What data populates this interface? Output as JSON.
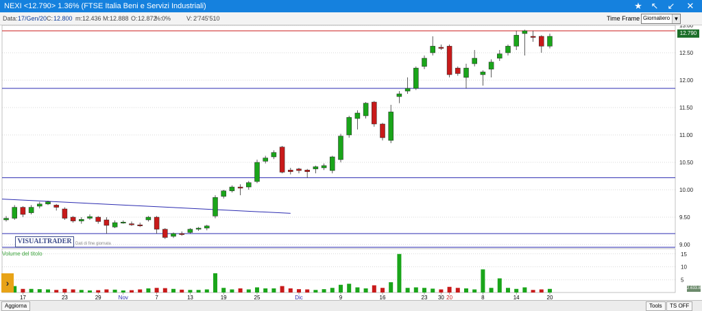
{
  "window": {
    "title": "NEXI <12.790> 1.36%  (FTSE Italia Beni e Servizi Industriali)"
  },
  "infobar": {
    "date_label": "Data:",
    "date": "17/Gen/20",
    "c_label": "C:",
    "c_value": "12.800",
    "m_label": "m:",
    "m_value": "12.436",
    "mx_label": "M:",
    "mx_value": "12.888",
    "o_label": "O:",
    "o_value": "12.872",
    "pct_label": "%:",
    "pct_value": "0%",
    "v_label": "V:",
    "v_value": "2'745'510"
  },
  "timeframe": {
    "label": "Time Frame",
    "selected": "Giornaliero"
  },
  "logo": {
    "text": "VISUALTRADER",
    "sub": "Dati di fine giornata"
  },
  "volume_label": "Volume del titolo",
  "price_badge": "12.790",
  "volume_badge": "2.633.8",
  "bottom": {
    "aggiorna": "Aggiorna",
    "tools": "Tools",
    "ts_off": "TS OFF"
  },
  "colors": {
    "up": "#1aa51a",
    "down": "#c81a1a",
    "titlebar": "#1581de",
    "support_line": "#2a2ab0",
    "resistance_line": "#c81a1a"
  },
  "chart_data": {
    "type": "candlestick",
    "y_ticks": [
      "13.00",
      "12.50",
      "12.00",
      "11.50",
      "11.00",
      "10.50",
      "10.00",
      "9.50",
      "9.00"
    ],
    "ylim": [
      8.95,
      13.0
    ],
    "volume_ticks": [
      "15",
      "10",
      "5"
    ],
    "volume_lim": [
      0,
      16
    ],
    "x_labels": [
      {
        "i": 2,
        "t": "17",
        "c": "#000"
      },
      {
        "i": 7,
        "t": "23",
        "c": "#000"
      },
      {
        "i": 11,
        "t": "29",
        "c": "#000"
      },
      {
        "i": 14,
        "t": "Nov",
        "c": "#2a2ab0"
      },
      {
        "i": 18,
        "t": "7",
        "c": "#000"
      },
      {
        "i": 22,
        "t": "13",
        "c": "#000"
      },
      {
        "i": 26,
        "t": "19",
        "c": "#000"
      },
      {
        "i": 30,
        "t": "25",
        "c": "#000"
      },
      {
        "i": 35,
        "t": "Dic",
        "c": "#2a2ab0"
      },
      {
        "i": 40,
        "t": "9",
        "c": "#000"
      },
      {
        "i": 45,
        "t": "16",
        "c": "#000"
      },
      {
        "i": 50,
        "t": "23",
        "c": "#000"
      },
      {
        "i": 52,
        "t": "30",
        "c": "#000"
      },
      {
        "i": 53,
        "t": "20",
        "c": "#c81a1a"
      },
      {
        "i": 57,
        "t": "8",
        "c": "#000"
      },
      {
        "i": 61,
        "t": "14",
        "c": "#000"
      },
      {
        "i": 65,
        "t": "20",
        "c": "#000"
      }
    ],
    "candles": [
      {
        "o": 9.45,
        "h": 9.52,
        "l": 9.42,
        "c": 9.48,
        "v": 1.5
      },
      {
        "o": 9.48,
        "h": 9.72,
        "l": 9.45,
        "c": 9.68,
        "v": 2.5
      },
      {
        "o": 9.68,
        "h": 9.7,
        "l": 9.5,
        "c": 9.55,
        "v": 1.4
      },
      {
        "o": 9.58,
        "h": 9.72,
        "l": 9.55,
        "c": 9.68,
        "v": 1.4
      },
      {
        "o": 9.7,
        "h": 9.78,
        "l": 9.66,
        "c": 9.74,
        "v": 1.3
      },
      {
        "o": 9.74,
        "h": 9.8,
        "l": 9.72,
        "c": 9.78,
        "v": 1.2
      },
      {
        "o": 9.72,
        "h": 9.74,
        "l": 9.62,
        "c": 9.68,
        "v": 1.0
      },
      {
        "o": 9.65,
        "h": 9.68,
        "l": 9.45,
        "c": 9.48,
        "v": 1.4
      },
      {
        "o": 9.5,
        "h": 9.52,
        "l": 9.4,
        "c": 9.43,
        "v": 1.2
      },
      {
        "o": 9.43,
        "h": 9.5,
        "l": 9.38,
        "c": 9.46,
        "v": 1.0
      },
      {
        "o": 9.48,
        "h": 9.55,
        "l": 9.45,
        "c": 9.51,
        "v": 0.8
      },
      {
        "o": 9.5,
        "h": 9.52,
        "l": 9.38,
        "c": 9.42,
        "v": 0.9
      },
      {
        "o": 9.45,
        "h": 9.5,
        "l": 9.2,
        "c": 9.35,
        "v": 1.2
      },
      {
        "o": 9.32,
        "h": 9.44,
        "l": 9.3,
        "c": 9.4,
        "v": 1.1
      },
      {
        "o": 9.4,
        "h": 9.44,
        "l": 9.38,
        "c": 9.41,
        "v": 0.8
      },
      {
        "o": 9.38,
        "h": 9.42,
        "l": 9.34,
        "c": 9.36,
        "v": 0.9
      },
      {
        "o": 9.36,
        "h": 9.4,
        "l": 9.32,
        "c": 9.34,
        "v": 1.2
      },
      {
        "o": 9.45,
        "h": 9.52,
        "l": 9.42,
        "c": 9.5,
        "v": 1.6
      },
      {
        "o": 9.5,
        "h": 9.52,
        "l": 9.2,
        "c": 9.28,
        "v": 1.8
      },
      {
        "o": 9.28,
        "h": 9.3,
        "l": 9.1,
        "c": 9.13,
        "v": 1.7
      },
      {
        "o": 9.15,
        "h": 9.22,
        "l": 9.12,
        "c": 9.2,
        "v": 1.4
      },
      {
        "o": 9.2,
        "h": 9.24,
        "l": 9.16,
        "c": 9.19,
        "v": 1.1
      },
      {
        "o": 9.22,
        "h": 9.3,
        "l": 9.2,
        "c": 9.28,
        "v": 1.0
      },
      {
        "o": 9.28,
        "h": 9.32,
        "l": 9.25,
        "c": 9.3,
        "v": 1.0
      },
      {
        "o": 9.3,
        "h": 9.36,
        "l": 9.26,
        "c": 9.34,
        "v": 1.2
      },
      {
        "o": 9.52,
        "h": 9.9,
        "l": 9.48,
        "c": 9.86,
        "v": 7.5
      },
      {
        "o": 9.88,
        "h": 10.0,
        "l": 9.84,
        "c": 9.98,
        "v": 1.8
      },
      {
        "o": 9.98,
        "h": 10.08,
        "l": 9.95,
        "c": 10.05,
        "v": 1.2
      },
      {
        "o": 10.05,
        "h": 10.1,
        "l": 9.9,
        "c": 10.03,
        "v": 1.6
      },
      {
        "o": 10.05,
        "h": 10.16,
        "l": 10.0,
        "c": 10.13,
        "v": 1.2
      },
      {
        "o": 10.15,
        "h": 10.55,
        "l": 10.12,
        "c": 10.5,
        "v": 2.0
      },
      {
        "o": 10.52,
        "h": 10.62,
        "l": 10.48,
        "c": 10.58,
        "v": 1.6
      },
      {
        "o": 10.6,
        "h": 10.72,
        "l": 10.56,
        "c": 10.68,
        "v": 1.6
      },
      {
        "o": 10.78,
        "h": 10.8,
        "l": 10.3,
        "c": 10.32,
        "v": 2.5
      },
      {
        "o": 10.36,
        "h": 10.4,
        "l": 10.28,
        "c": 10.33,
        "v": 1.6
      },
      {
        "o": 10.38,
        "h": 10.4,
        "l": 10.3,
        "c": 10.35,
        "v": 1.3
      },
      {
        "o": 10.36,
        "h": 10.38,
        "l": 10.22,
        "c": 10.33,
        "v": 1.2
      },
      {
        "o": 10.38,
        "h": 10.44,
        "l": 10.3,
        "c": 10.42,
        "v": 1.0
      },
      {
        "o": 10.4,
        "h": 10.48,
        "l": 10.36,
        "c": 10.44,
        "v": 1.3
      },
      {
        "o": 10.35,
        "h": 10.62,
        "l": 10.3,
        "c": 10.6,
        "v": 1.8
      },
      {
        "o": 10.55,
        "h": 11.02,
        "l": 10.5,
        "c": 10.98,
        "v": 3.0
      },
      {
        "o": 11.0,
        "h": 11.35,
        "l": 10.95,
        "c": 11.32,
        "v": 3.4
      },
      {
        "o": 11.3,
        "h": 11.45,
        "l": 11.1,
        "c": 11.4,
        "v": 2.0
      },
      {
        "o": 11.35,
        "h": 11.6,
        "l": 11.3,
        "c": 11.58,
        "v": 1.6
      },
      {
        "o": 11.6,
        "h": 11.62,
        "l": 11.15,
        "c": 11.2,
        "v": 2.8
      },
      {
        "o": 11.2,
        "h": 11.22,
        "l": 10.9,
        "c": 10.95,
        "v": 1.8
      },
      {
        "o": 10.9,
        "h": 11.55,
        "l": 10.85,
        "c": 11.42,
        "v": 4.0
      },
      {
        "o": 11.7,
        "h": 11.8,
        "l": 11.58,
        "c": 11.75,
        "v": 15.0
      },
      {
        "o": 11.8,
        "h": 12.05,
        "l": 11.75,
        "c": 11.85,
        "v": 1.8
      },
      {
        "o": 11.85,
        "h": 12.25,
        "l": 11.82,
        "c": 12.22,
        "v": 2.0
      },
      {
        "o": 12.25,
        "h": 12.45,
        "l": 12.2,
        "c": 12.4,
        "v": 1.8
      },
      {
        "o": 12.5,
        "h": 12.8,
        "l": 12.45,
        "c": 12.62,
        "v": 1.5
      },
      {
        "o": 12.6,
        "h": 12.65,
        "l": 12.55,
        "c": 12.58,
        "v": 1.2
      },
      {
        "o": 12.62,
        "h": 12.65,
        "l": 12.05,
        "c": 12.1,
        "v": 2.2
      },
      {
        "o": 12.22,
        "h": 12.25,
        "l": 12.08,
        "c": 12.12,
        "v": 1.8
      },
      {
        "o": 12.05,
        "h": 12.3,
        "l": 11.85,
        "c": 12.22,
        "v": 1.6
      },
      {
        "o": 12.3,
        "h": 12.55,
        "l": 12.25,
        "c": 12.4,
        "v": 1.2
      },
      {
        "o": 12.1,
        "h": 12.18,
        "l": 11.9,
        "c": 12.15,
        "v": 9.0
      },
      {
        "o": 12.2,
        "h": 12.38,
        "l": 12.05,
        "c": 12.33,
        "v": 1.8
      },
      {
        "o": 12.4,
        "h": 12.55,
        "l": 12.35,
        "c": 12.48,
        "v": 5.5
      },
      {
        "o": 12.5,
        "h": 12.65,
        "l": 12.45,
        "c": 12.62,
        "v": 1.8
      },
      {
        "o": 12.62,
        "h": 12.9,
        "l": 12.55,
        "c": 12.82,
        "v": 1.4
      },
      {
        "o": 12.85,
        "h": 12.92,
        "l": 12.45,
        "c": 12.9,
        "v": 2.0
      },
      {
        "o": 12.8,
        "h": 12.9,
        "l": 12.7,
        "c": 12.78,
        "v": 1.0
      },
      {
        "o": 12.8,
        "h": 12.82,
        "l": 12.5,
        "c": 12.62,
        "v": 1.2
      },
      {
        "o": 12.62,
        "h": 12.85,
        "l": 12.58,
        "c": 12.8,
        "v": 1.4
      }
    ],
    "hlines": [
      {
        "y": 12.9,
        "color": "#c81a1a"
      },
      {
        "y": 11.85,
        "color": "#2a2ab0"
      },
      {
        "y": 10.22,
        "color": "#2a2ab0"
      },
      {
        "y": 9.2,
        "color": "#2a2ab0"
      },
      {
        "y": 8.95,
        "color": "#2a2ab0"
      }
    ],
    "trendline": {
      "i1": 0,
      "y1": 9.83,
      "i2": 34,
      "y2": 9.57,
      "color": "#2a2ab0"
    }
  }
}
